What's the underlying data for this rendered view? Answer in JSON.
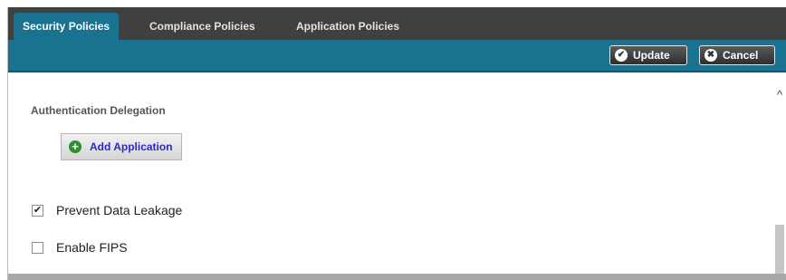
{
  "tabs": [
    {
      "label": "Security Policies",
      "active": true
    },
    {
      "label": "Compliance Policies",
      "active": false
    },
    {
      "label": "Application Policies",
      "active": false
    }
  ],
  "toolbar": {
    "update_label": "Update",
    "cancel_label": "Cancel",
    "update_icon": "check-circle-icon",
    "cancel_icon": "x-circle-icon"
  },
  "content": {
    "section_title": "Authentication Delegation",
    "add_application_label": "Add Application",
    "add_application_icon": "plus-circle-icon",
    "prevent_data_leakage": {
      "label": "Prevent Data Leakage",
      "checked": true
    },
    "enable_fips": {
      "label": "Enable FIPS",
      "checked": false
    }
  },
  "colors": {
    "tab_bar": "#404040",
    "accent": "#1a7291",
    "link_blue": "#2a2ac8",
    "add_green": "#2f8f2f"
  }
}
